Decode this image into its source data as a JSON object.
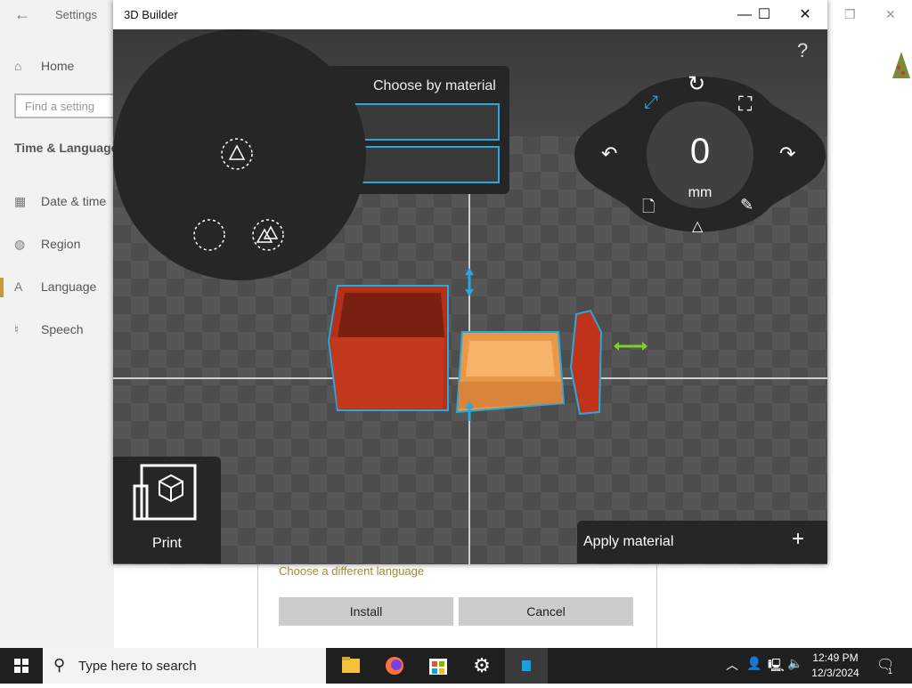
{
  "settings": {
    "title": "Settings",
    "nav": [
      {
        "label": "Home",
        "icon": "home-icon"
      },
      {
        "label": "Date & time",
        "icon": "calendar-icon"
      },
      {
        "label": "Region",
        "icon": "globe-icon"
      },
      {
        "label": "Language",
        "icon": "language-icon"
      },
      {
        "label": "Speech",
        "icon": "microphone-icon"
      }
    ],
    "search_placeholder": "Find a setting",
    "section": "Time & Language",
    "choose_link": "Choose a different language",
    "install_label": "Install",
    "cancel_label": "Cancel"
  },
  "builder": {
    "title": "3D Builder",
    "help": "?",
    "material_panel_title": "Choose by material",
    "dial_value": "0",
    "dial_unit": "mm",
    "print_label": "Print",
    "apply_label": "Apply material",
    "apply_plus": "+"
  },
  "taskbar": {
    "search_placeholder": "Type here to search",
    "time": "12:49 PM",
    "date": "12/3/2024",
    "notification_count": "1"
  },
  "colors": {
    "accent": "#29a8e0",
    "panel": "#262626",
    "red_object": "#c0331a",
    "orange_object": "#f0a050",
    "gizmo_green": "#7ed321"
  }
}
